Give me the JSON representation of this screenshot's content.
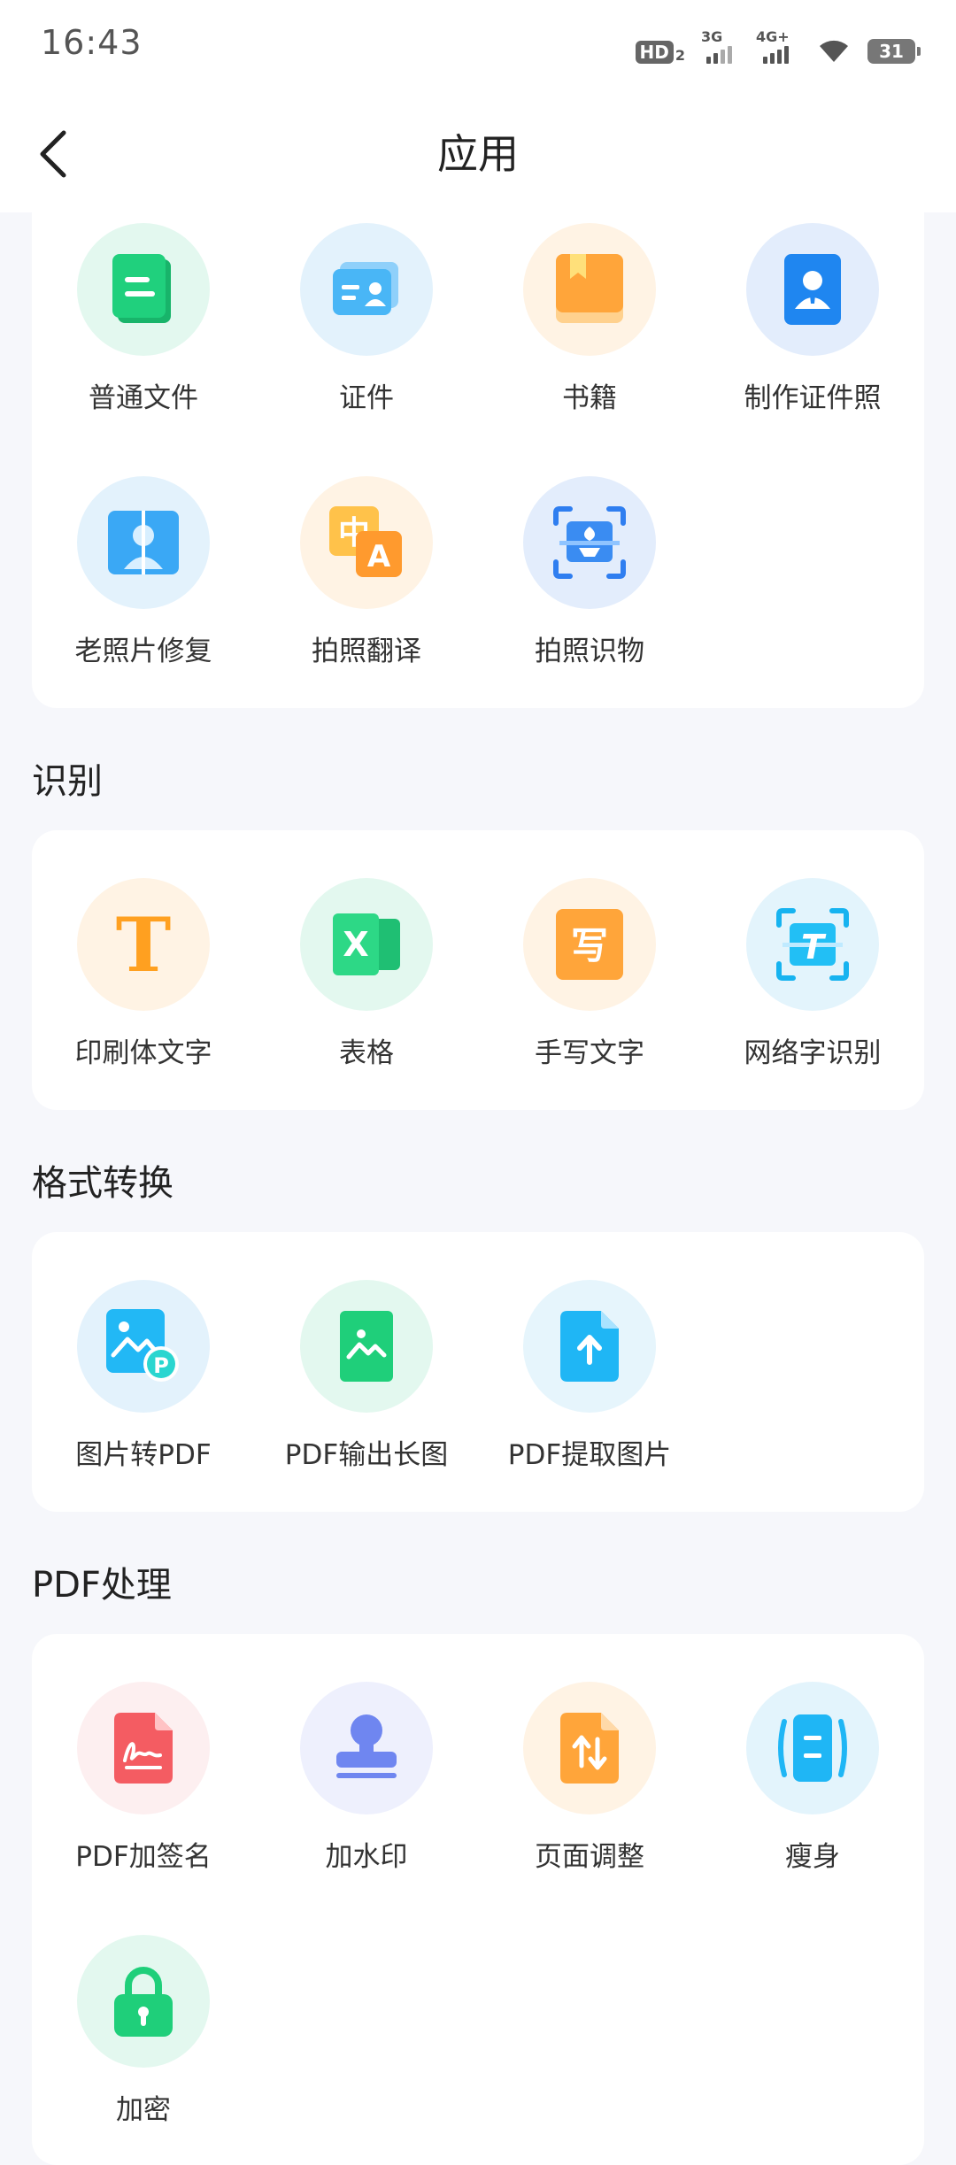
{
  "status_bar": {
    "time": "16:43",
    "hd_label": "HD",
    "hd_sub": "2",
    "signal1_label": "3G",
    "signal2_label": "4G+",
    "battery": "31"
  },
  "header": {
    "title": "应用"
  },
  "sections": {
    "scan": {
      "items": [
        "普通文件",
        "证件",
        "书籍",
        "制作证件照",
        "老照片修复",
        "拍照翻译",
        "拍照识物"
      ]
    },
    "recognize": {
      "title": "识别",
      "items": [
        "印刷体文字",
        "表格",
        "手写文字",
        "网络字识别"
      ]
    },
    "convert": {
      "title": "格式转换",
      "items": [
        "图片转PDF",
        "PDF输出长图",
        "PDF提取图片"
      ]
    },
    "pdf": {
      "title": "PDF处理",
      "items": [
        "PDF加签名",
        "加水印",
        "页面调整",
        "瘦身",
        "加密"
      ]
    }
  },
  "icon_glyphs": {
    "print_text": "T",
    "excel": "X",
    "handwrite": "写",
    "web_text": "T",
    "translate_zh": "中",
    "translate_a": "A",
    "pdf_p": "P"
  },
  "colors": {
    "green": "#1ec879",
    "blue": "#2f9bf0",
    "orange": "#ffa53a",
    "red": "#f25a5f",
    "purple": "#6f86f0"
  }
}
